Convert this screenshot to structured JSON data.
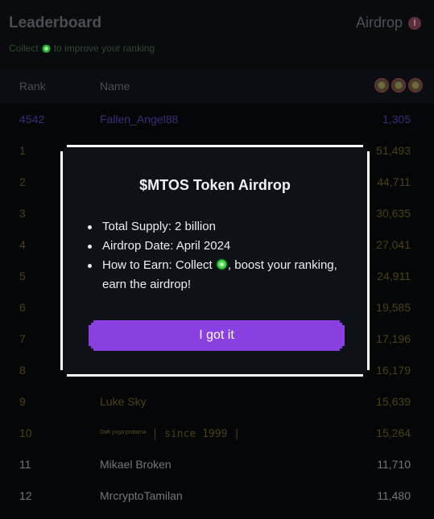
{
  "header": {
    "title": "Leaderboard",
    "airdrop_label": "Airdrop",
    "info_glyph": "!",
    "subtitle_before": "Collect",
    "subtitle_after": "to improve your ranking"
  },
  "table": {
    "columns": {
      "rank": "Rank",
      "name": "Name"
    },
    "current_user": {
      "rank": "4542",
      "name": "Fallen_Angel88",
      "score": "1,305"
    },
    "rows": [
      {
        "rank": "1",
        "name": "",
        "score": "51,493"
      },
      {
        "rank": "2",
        "name": "",
        "score": "44,711"
      },
      {
        "rank": "3",
        "name": "",
        "score": "30,635"
      },
      {
        "rank": "4",
        "name": "",
        "score": "27,041"
      },
      {
        "rank": "5",
        "name": "",
        "score": "24,911"
      },
      {
        "rank": "6",
        "name": "",
        "score": "19,585"
      },
      {
        "rank": "7",
        "name": "",
        "score": "17,196"
      },
      {
        "rank": "8",
        "name": "",
        "score": "16,179"
      },
      {
        "rank": "9",
        "name": "Luke Sky",
        "score": "15,639"
      },
      {
        "rank": "10",
        "name": "Daft yoga pratama",
        "name_suffix": "| since 1999 |",
        "score": "15,264"
      },
      {
        "rank": "11",
        "name": "Mikael Broken",
        "score": "11,710"
      },
      {
        "rank": "12",
        "name": "MrcryptoTamilan",
        "score": "11,480"
      }
    ]
  },
  "modal": {
    "title": "$MTOS Token Airdrop",
    "item_supply": "Total Supply: 2 billion",
    "item_date": "Airdrop Date: April 2024",
    "item_earn_before": "How to Earn: Collect",
    "item_earn_after": ", boost your ranking, earn the airdrop!",
    "button_label": "I got it"
  },
  "colors": {
    "accent": "#8a3fe0",
    "background": "#050608",
    "modal_background": "#0f1119"
  },
  "icons": {
    "info": "info-icon",
    "coin": "mtos-coin-icon"
  }
}
